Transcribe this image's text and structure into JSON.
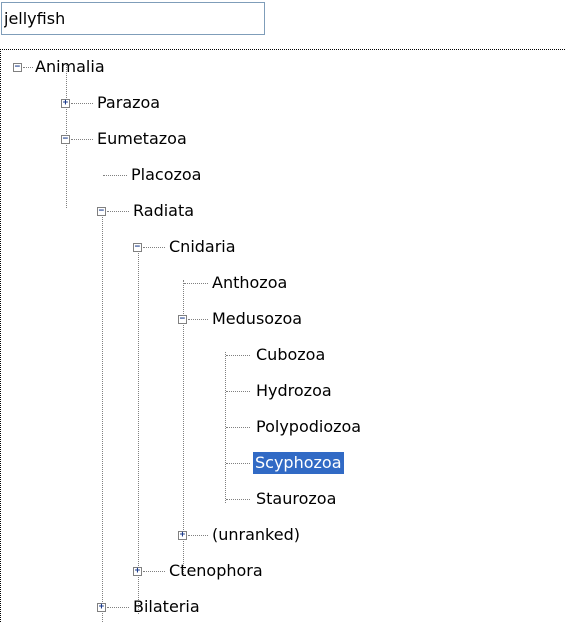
{
  "search": {
    "value": "jellyfish"
  },
  "tree": {
    "nodes": [
      {
        "label": "Animalia",
        "state": "expanded"
      },
      {
        "label": "Parazoa",
        "state": "collapsed"
      },
      {
        "label": "Eumetazoa",
        "state": "expanded"
      },
      {
        "label": "Placozoa",
        "state": "leaf"
      },
      {
        "label": "Radiata",
        "state": "expanded"
      },
      {
        "label": "Cnidaria",
        "state": "expanded"
      },
      {
        "label": "Anthozoa",
        "state": "leaf"
      },
      {
        "label": "Medusozoa",
        "state": "expanded"
      },
      {
        "label": "Cubozoa",
        "state": "leaf"
      },
      {
        "label": "Hydrozoa",
        "state": "leaf"
      },
      {
        "label": "Polypodiozoa",
        "state": "leaf"
      },
      {
        "label": "Scyphozoa",
        "state": "leaf",
        "selected": true
      },
      {
        "label": "Staurozoa",
        "state": "leaf"
      },
      {
        "label": "(unranked)",
        "state": "collapsed"
      },
      {
        "label": "Ctenophora",
        "state": "collapsed"
      },
      {
        "label": "Bilateria",
        "state": "collapsed"
      }
    ]
  },
  "colors": {
    "selection_bg": "#316ac5",
    "selection_text": "#ffffff",
    "input_border": "#7f9db9",
    "tree_lines": "#808080"
  }
}
